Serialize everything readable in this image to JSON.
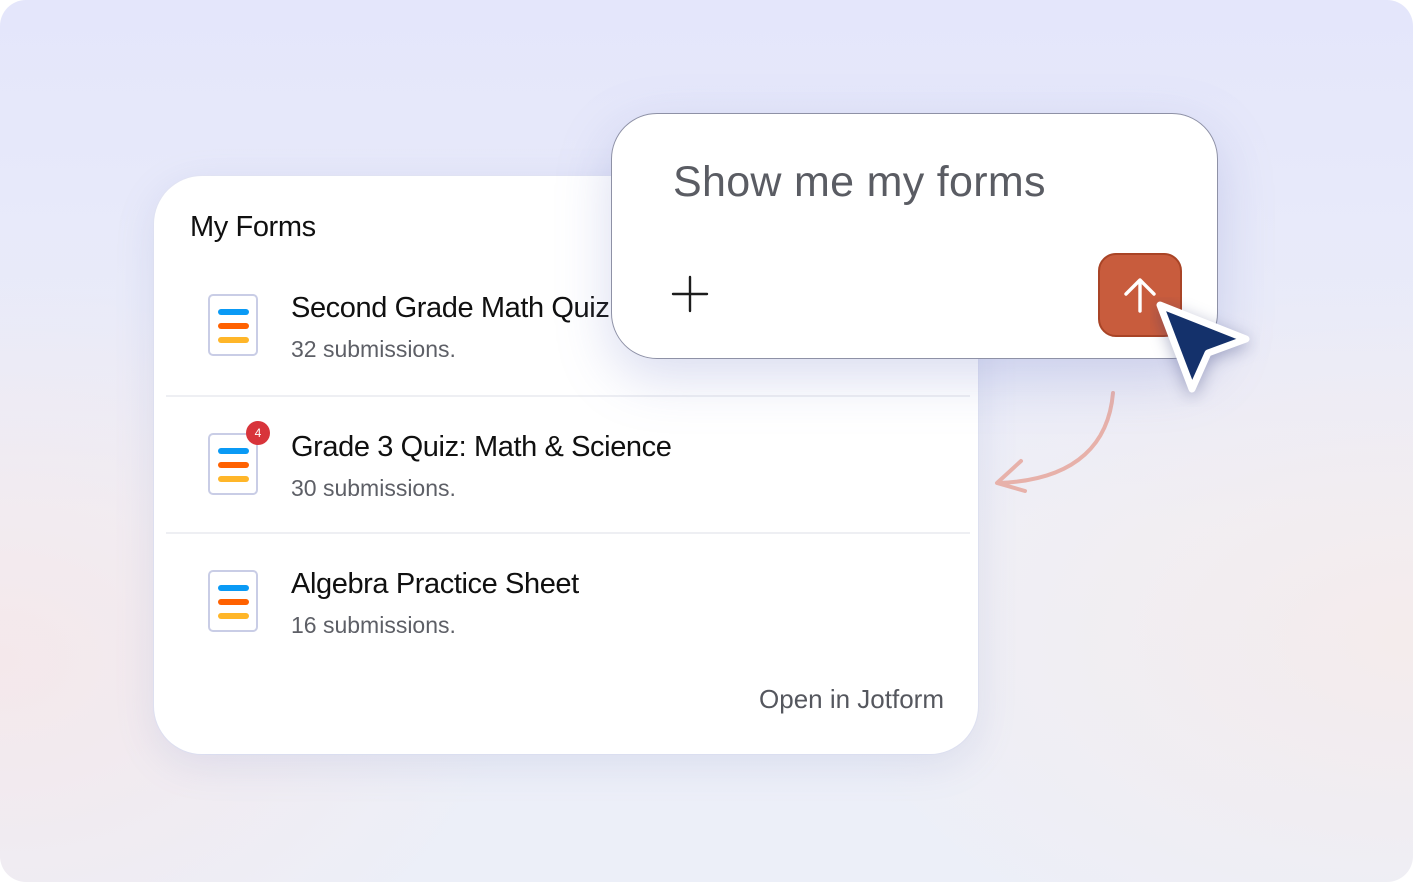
{
  "forms_panel": {
    "title": "My Forms",
    "forms": [
      {
        "name": "Second Grade Math Quiz",
        "submissions": "32 submissions.",
        "badge": ""
      },
      {
        "name": "Grade 3 Quiz: Math & Science",
        "submissions": "30 submissions.",
        "badge": "4"
      },
      {
        "name": "Algebra Practice Sheet",
        "submissions": "16 submissions.",
        "badge": ""
      }
    ],
    "open_link": "Open in Jotform"
  },
  "prompt": {
    "text": "Show me my forms",
    "add_icon": "plus-icon",
    "send_icon": "arrow-up-icon"
  },
  "colors": {
    "send_button": "#c85c3d",
    "cursor": "#14316b",
    "badge": "#d8343b",
    "form_bar_blue": "#0a9af5",
    "form_bar_orange": "#ff6100",
    "form_bar_yellow": "#ffb629"
  }
}
